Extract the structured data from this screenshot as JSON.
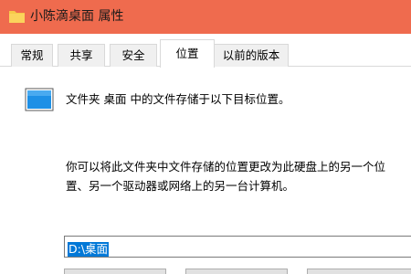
{
  "window": {
    "title": "小陈滴桌面 属性",
    "icon": "folder-icon"
  },
  "tabs": [
    {
      "label": "常规",
      "active": false
    },
    {
      "label": "共享",
      "active": false
    },
    {
      "label": "安全",
      "active": false
    },
    {
      "label": "位置",
      "active": true
    },
    {
      "label": "以前的版本",
      "active": false
    }
  ],
  "location": {
    "info": "文件夹 桌面 中的文件存储于以下目标位置。",
    "description_line1": "你可以将此文件夹中文件存储的位置更改为此硬盘上的另一个位",
    "description_line2": "置、另一个驱动器或网络上的另一台计算机。",
    "path": "D:\\桌面"
  },
  "colors": {
    "titlebar": "#ef6b4e",
    "selection": "#0078d7",
    "desktop_icon": "#1e90e6"
  }
}
